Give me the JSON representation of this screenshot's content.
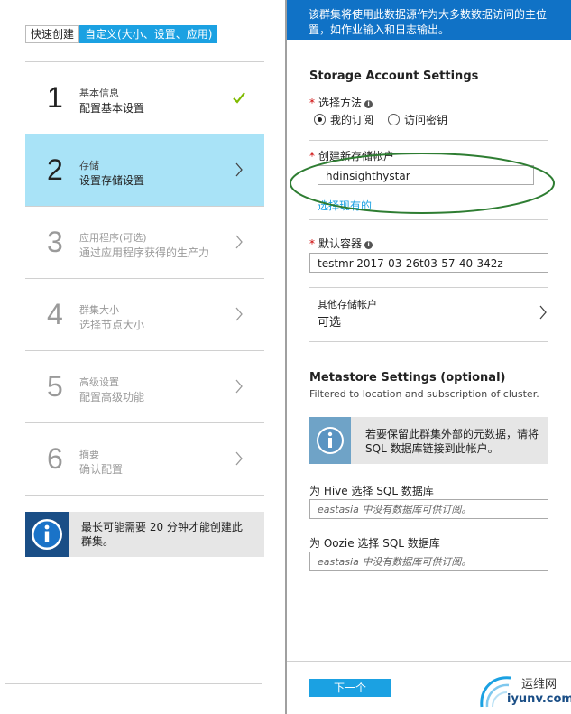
{
  "left_blade": {
    "mode_toggle": {
      "quick": "快速创建",
      "custom": "自定义(大小、设置、应用)"
    },
    "steps": [
      {
        "number": "1",
        "title": "基本信息",
        "subtitle": "配置基本设置",
        "state": "done",
        "icon": "checkmark-icon"
      },
      {
        "number": "2",
        "title": "存储",
        "subtitle": "设置存储设置",
        "state": "active",
        "icon": "chevron-right-icon"
      },
      {
        "number": "3",
        "title": "应用程序(可选)",
        "subtitle": "通过应用程序获得的生产力",
        "state": "disabled",
        "icon": "chevron-right-icon"
      },
      {
        "number": "4",
        "title": "群集大小",
        "subtitle": "选择节点大小",
        "state": "disabled",
        "icon": "chevron-right-icon"
      },
      {
        "number": "5",
        "title": "高级设置",
        "subtitle": "配置高级功能",
        "state": "disabled",
        "icon": "chevron-right-icon"
      },
      {
        "number": "6",
        "title": "摘要",
        "subtitle": "确认配置",
        "state": "disabled",
        "icon": "chevron-right-icon"
      }
    ],
    "info_text": "最长可能需要 20 分钟才能创建此群集。"
  },
  "right_blade": {
    "banner_text": "该群集将使用此数据源作为大多数数据访问的主位置，如作业输入和日志输出。",
    "storage": {
      "heading": "Storage Account Settings",
      "method_label": "选择方法",
      "method_options": [
        "我的订阅",
        "访问密钥"
      ],
      "method_selected": "我的订阅",
      "create_label": "创建新存储帐户",
      "create_value": "hdinsighthystar",
      "select_existing_link": "选择现有的",
      "container_label": "默认容器",
      "container_value": "testmr-2017-03-26t03-57-40-342z",
      "other_title": "其他存储帐户",
      "other_value": "可选"
    },
    "metastore": {
      "heading": "Metastore Settings (optional)",
      "subheading": "Filtered to location and subscription of cluster.",
      "info_text": "若要保留此群集外部的元数据，请将 SQL 数据库链接到此帐户。",
      "hive_label": "为 Hive 选择 SQL 数据库",
      "hive_placeholder": "eastasia 中没有数据库可供订阅。",
      "oozie_label": "为 Oozie 选择 SQL 数据库",
      "oozie_placeholder": "eastasia 中没有数据库可供订阅。"
    },
    "next_button": "下一个",
    "watermark": {
      "line1": "运维网",
      "line2": "iyunv.com"
    }
  },
  "colors": {
    "accent": "#1ba1e2",
    "active_step": "#a9e3f7",
    "banner": "#1072c6",
    "info_icon_bg": "#1a4e86",
    "checkmark": "#7fba00",
    "annotation_ellipse": "#2e7d32"
  }
}
